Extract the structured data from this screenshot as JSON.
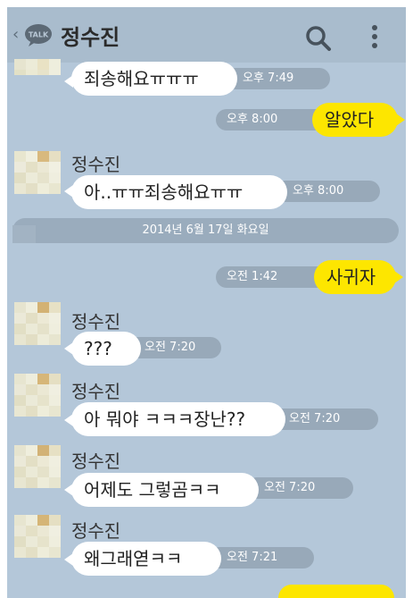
{
  "header": {
    "title": "정수진",
    "back_glyph": "‹",
    "app_badge": "TALK"
  },
  "date_separator": "2014년 6월 17일 화요일",
  "messages": [
    {
      "id": "m1",
      "side": "in",
      "text": "죄송해요ㅠㅠㅠ",
      "time": "오후 7:49"
    },
    {
      "id": "m2",
      "side": "out",
      "text": "알았다",
      "time": "오후 8:00"
    },
    {
      "id": "m3",
      "side": "in",
      "sender": "정수진",
      "text": "아..ㅠㅠ죄송해요ㅠㅠ",
      "time": "오후 8:00"
    },
    {
      "id": "m4",
      "side": "out",
      "text": "사귀자",
      "time": "오전 1:42"
    },
    {
      "id": "m5",
      "side": "in",
      "sender": "정수진",
      "text": "???",
      "time": "오전 7:20"
    },
    {
      "id": "m6",
      "side": "in",
      "sender": "정수진",
      "text": "아 뭐야 ㅋㅋㅋ장난??",
      "time": "오전 7:20"
    },
    {
      "id": "m7",
      "side": "in",
      "sender": "정수진",
      "text": "어제도 그렇곰ㅋㅋ",
      "time": "오전 7:20"
    },
    {
      "id": "m8",
      "side": "in",
      "sender": "정수진",
      "text": "왜그래엳ㅋㅋ",
      "time": "오전 7:21"
    }
  ],
  "colors": {
    "background": "#b4c7d9",
    "outgoing_bubble": "#fde600",
    "incoming_bubble": "#ffffff",
    "timestamp_pill": "#98a9b9"
  },
  "icons": [
    "back-chevron-icon",
    "talk-bubble-icon",
    "search-icon",
    "more-vertical-icon"
  ]
}
